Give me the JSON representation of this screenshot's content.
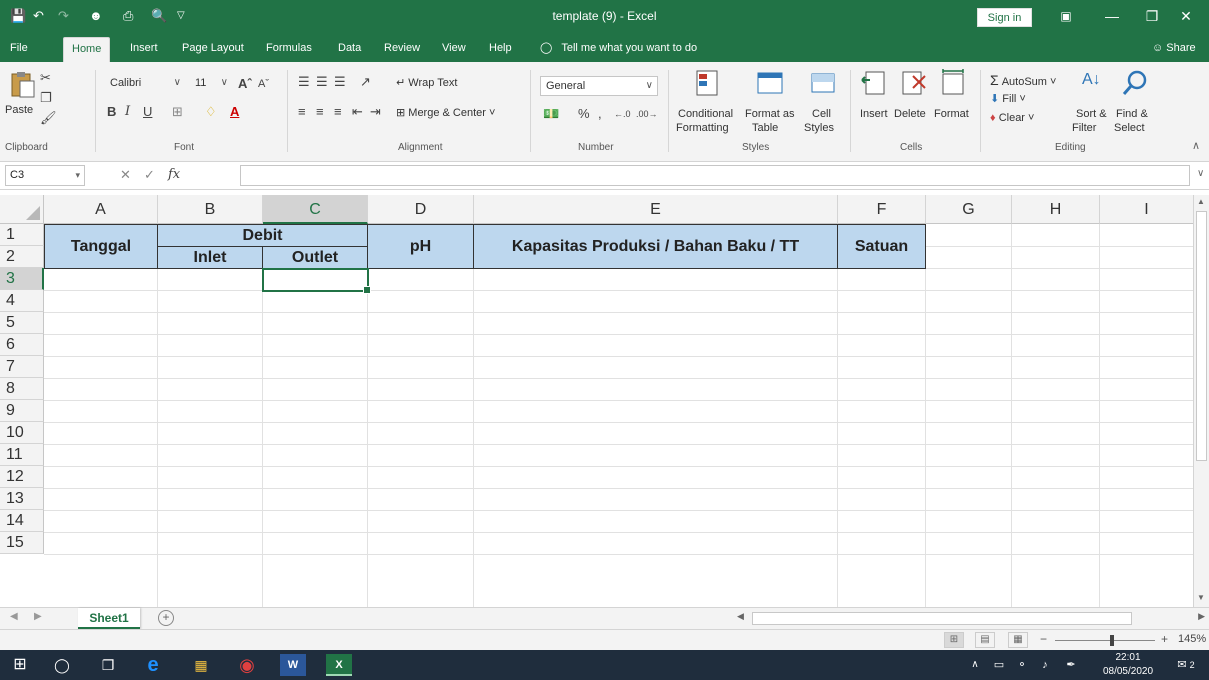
{
  "title_bar": {
    "doc_title": "template (9)  -  Excel",
    "sign_in": "Sign in"
  },
  "menu": {
    "tabs": [
      "File",
      "Home",
      "Insert",
      "Page Layout",
      "Formulas",
      "Data",
      "Review",
      "View",
      "Help"
    ],
    "active_tab": "Home",
    "tell_me": "Tell me what you want to do",
    "share": "Share"
  },
  "ribbon": {
    "clipboard": {
      "paste": "Paste",
      "label": "Clipboard"
    },
    "font": {
      "name": "Calibri",
      "size": "11",
      "label": "Font"
    },
    "alignment": {
      "wrap_text": "Wrap Text",
      "merge_center": "Merge & Center",
      "label": "Alignment"
    },
    "number": {
      "format": "General",
      "label": "Number"
    },
    "styles": {
      "conditional_1": "Conditional",
      "conditional_2": "Formatting",
      "format_as_1": "Format as",
      "format_as_2": "Table",
      "cell_styles_1": "Cell",
      "cell_styles_2": "Styles",
      "label": "Styles"
    },
    "cells": {
      "insert": "Insert",
      "delete": "Delete",
      "format": "Format",
      "label": "Cells"
    },
    "editing": {
      "autosum": "AutoSum",
      "fill": "Fill",
      "clear": "Clear",
      "sort_1": "Sort &",
      "sort_2": "Filter",
      "find_1": "Find &",
      "find_2": "Select",
      "label": "Editing"
    }
  },
  "formula_bar": {
    "name_box": "C3",
    "formula": ""
  },
  "grid": {
    "columns": [
      "A",
      "B",
      "C",
      "D",
      "E",
      "F",
      "G",
      "H",
      "I"
    ],
    "rows": [
      "1",
      "2",
      "3",
      "4",
      "5",
      "6",
      "7",
      "8",
      "9",
      "10",
      "11",
      "12",
      "13",
      "14",
      "15"
    ],
    "selected_column": "C",
    "selected_row": "3",
    "header_cells": {
      "tanggal": "Tanggal",
      "debit": "Debit",
      "inlet": "Inlet",
      "outlet": "Outlet",
      "ph": "pH",
      "kapasitas": "Kapasitas Produksi / Bahan Baku / TT",
      "satuan": "Satuan"
    },
    "header_fill": "#BDD7EE"
  },
  "sheets": {
    "tabs": [
      "Sheet1"
    ],
    "active": "Sheet1"
  },
  "status_bar": {
    "zoom": "145%"
  },
  "taskbar": {
    "time": "22:01",
    "date": "08/05/2020",
    "notifications": "2"
  },
  "colors": {
    "accent": "#217346",
    "ribbon_bg": "#F3F3F3",
    "taskbar_bg": "#1F2D3D"
  }
}
